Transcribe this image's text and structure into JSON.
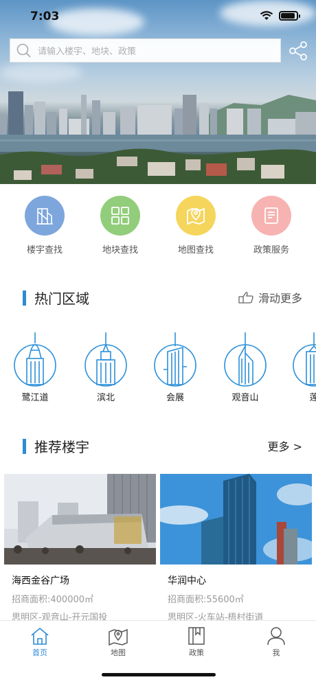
{
  "status_bar": {
    "time": "7:03"
  },
  "search": {
    "placeholder": "请输入楼宇、地块、政策"
  },
  "categories": [
    {
      "label": "楼宇查找",
      "icon": "building-search-icon",
      "color": "#7da6dc"
    },
    {
      "label": "地块查找",
      "icon": "grid-blocks-icon",
      "color": "#92cd7b"
    },
    {
      "label": "地图查找",
      "icon": "map-pin-icon",
      "color": "#f5d55b"
    },
    {
      "label": "政策服务",
      "icon": "document-icon",
      "color": "#f6b3b1"
    }
  ],
  "hot_areas": {
    "title": "热门区域",
    "more": "滑动更多",
    "items": [
      {
        "label": "鹭江道"
      },
      {
        "label": "滨北"
      },
      {
        "label": "会展"
      },
      {
        "label": "观音山"
      },
      {
        "label": "莲"
      }
    ]
  },
  "recommended": {
    "title": "推荐楼宇",
    "more": "更多 >",
    "items": [
      {
        "name": "海西金谷广场",
        "area": "招商面积:400000㎡",
        "location": "思明区-观音山-开元国投"
      },
      {
        "name": "华润中心",
        "area": "招商面积:55600㎡",
        "location": "思明区-火车站-梧村街道"
      }
    ]
  },
  "tabbar": {
    "items": [
      {
        "label": "首页",
        "icon": "home-icon",
        "active": true
      },
      {
        "label": "地图",
        "icon": "map-icon",
        "active": false
      },
      {
        "label": "政策",
        "icon": "book-icon",
        "active": false
      },
      {
        "label": "我",
        "icon": "person-icon",
        "active": false
      }
    ]
  },
  "colors": {
    "accent": "#2d8bd6",
    "icon_blue": "#2b8fd9"
  }
}
